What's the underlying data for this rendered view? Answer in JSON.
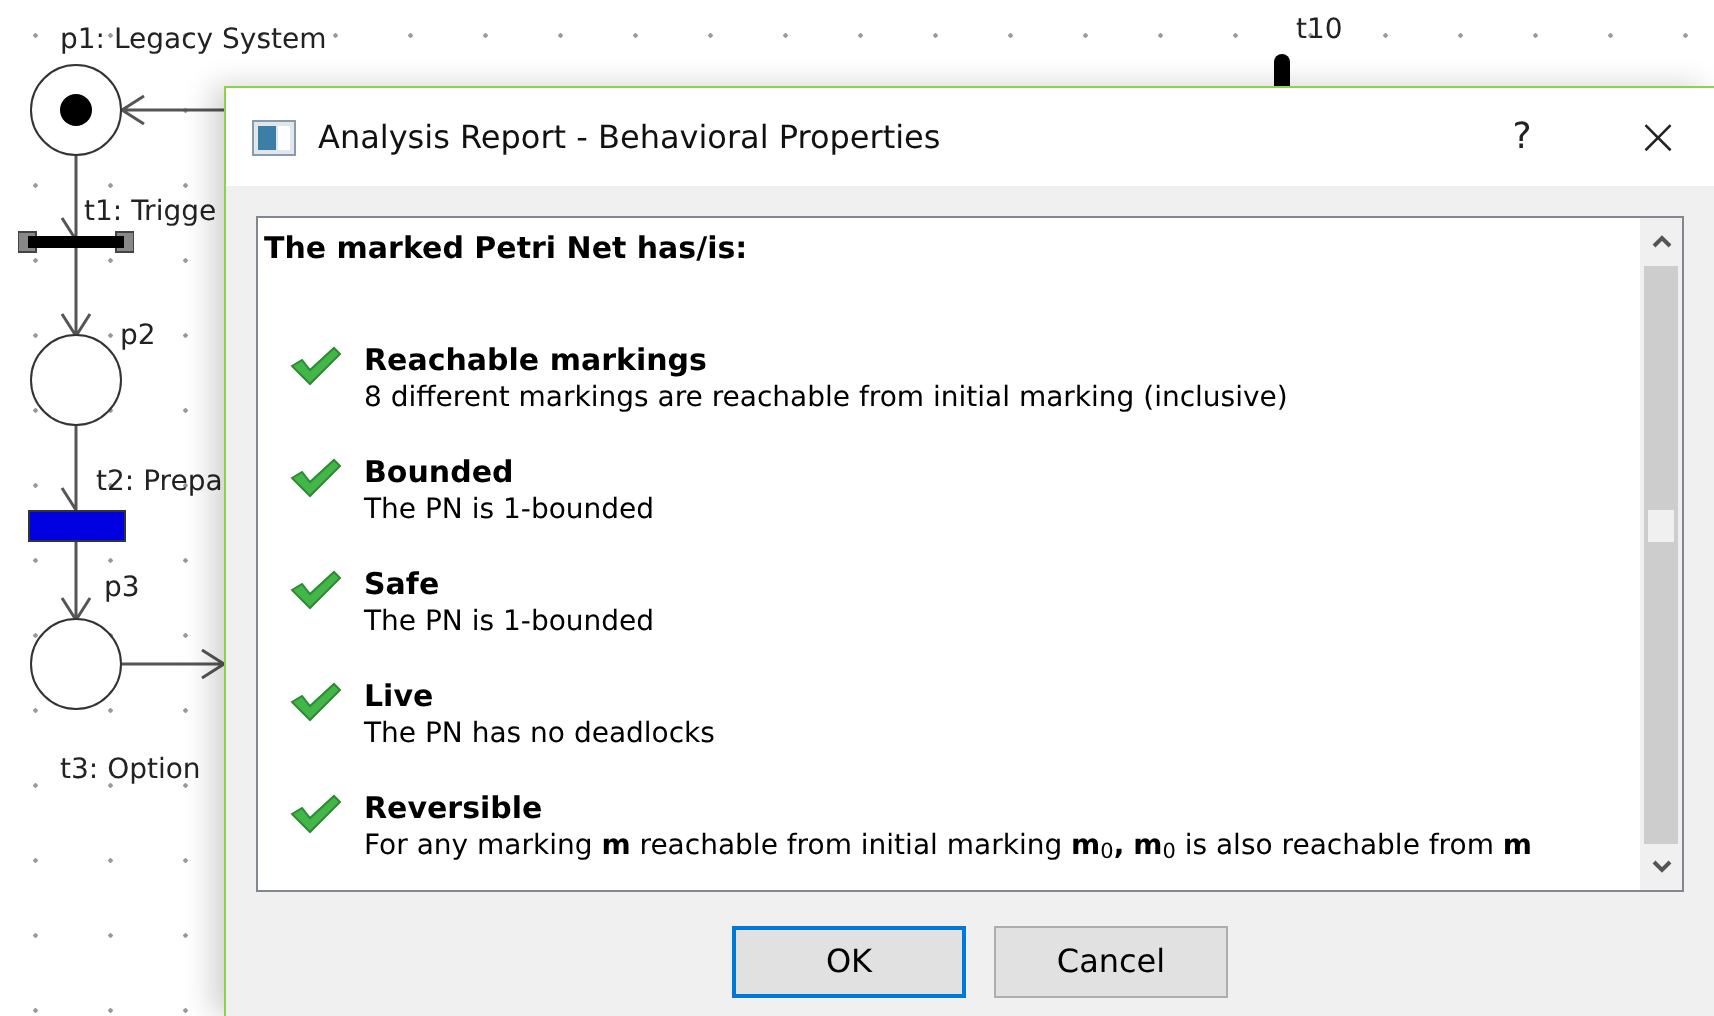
{
  "canvas": {
    "places": [
      {
        "label": "p1: Legacy System",
        "marked": true
      },
      {
        "label": "p2",
        "marked": false
      },
      {
        "label": "p3",
        "marked": false
      }
    ],
    "transitions": [
      {
        "label": "t1: Trigge",
        "kind": "bar"
      },
      {
        "label": "t2: Prepa",
        "kind": "block"
      },
      {
        "label": "t3: Option",
        "kind": "hidden"
      },
      {
        "label": "t10",
        "kind": "small"
      }
    ]
  },
  "dialog": {
    "title": "Analysis Report - Behavioral Properties",
    "help": "?",
    "close": "×",
    "heading": "The marked Petri Net has/is:",
    "properties": [
      {
        "name": "Reachable markings",
        "description": "8 different markings are reachable from initial marking (inclusive)",
        "passed": true
      },
      {
        "name": "Bounded",
        "description": "The PN is 1-bounded",
        "passed": true
      },
      {
        "name": "Safe",
        "description": "The PN is 1-bounded",
        "passed": true
      },
      {
        "name": "Live",
        "description": "The PN has no deadlocks",
        "passed": true
      },
      {
        "name": "Reversible",
        "description": "For any marking **m** reachable from initial marking **m**$_{0}$**,** **m**$_{0}$ is also reachable from **m**",
        "passed": true
      }
    ],
    "buttons": [
      {
        "label": "OK",
        "selected": true
      },
      {
        "label": "Cancel",
        "selected": false
      }
    ]
  }
}
